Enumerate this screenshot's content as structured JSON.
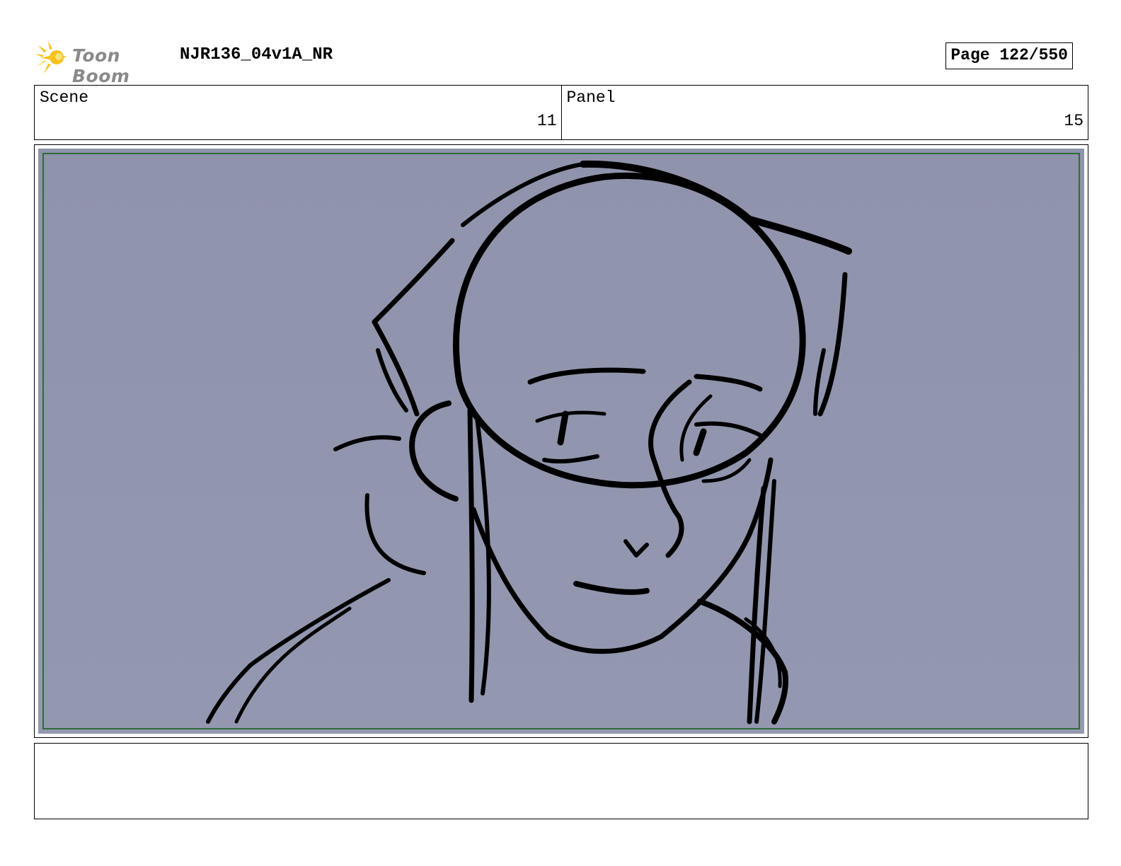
{
  "header": {
    "logo_text": "Toon Boom",
    "doc_title": "NJR136_04v1A_NR",
    "page_label": "Page 122/550"
  },
  "info": {
    "scene_label": "Scene",
    "scene_value": "11",
    "panel_label": "Panel",
    "panel_value": "15"
  },
  "panel": {
    "description": "",
    "background_color": "#9095ad",
    "safe_frame_color": "#2e6b3a"
  },
  "notes": {
    "text": ""
  }
}
